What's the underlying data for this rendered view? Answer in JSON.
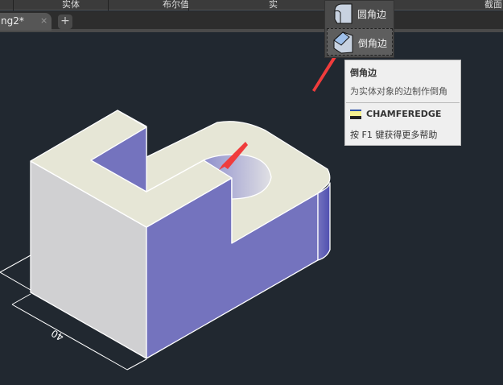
{
  "ribbon": {
    "panels": [
      "实体",
      "布尔值",
      "实",
      "截面"
    ]
  },
  "tabs": {
    "document": "ng2*",
    "close": "×",
    "new": "+"
  },
  "dropdown": {
    "items": [
      {
        "label": "圆角边",
        "icon": "fillet-edge-icon"
      },
      {
        "label": "倒角边",
        "icon": "chamfer-edge-icon",
        "selected": true
      }
    ]
  },
  "tooltip": {
    "title": "倒角边",
    "description": "为实体对象的边制作倒角",
    "command": "CHAMFEREDGE",
    "help": "按 F1 键获得更多帮助"
  },
  "drawing": {
    "dimension": "40",
    "colors": {
      "top": "#e6e6d6",
      "front": "#d0d0d2",
      "side": "#7473be",
      "background": "#212830",
      "arrow": "#f03c3c"
    }
  }
}
